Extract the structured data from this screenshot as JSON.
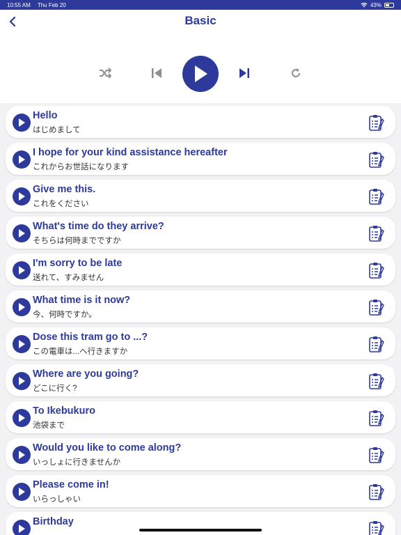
{
  "status_bar": {
    "time": "10:55 AM",
    "date": "Thu Feb 20",
    "battery": "43%",
    "wifi_icon": "wifi-icon",
    "battery_icon": "battery-icon"
  },
  "header": {
    "title": "Basic",
    "back_icon": "chevron-left-icon"
  },
  "player": {
    "shuffle_icon": "shuffle-icon",
    "prev_icon": "skip-previous-icon",
    "play_icon": "play-icon",
    "next_icon": "skip-next-icon",
    "repeat_icon": "repeat-icon"
  },
  "colors": {
    "accent": "#2d3a9b",
    "inactive_icon": "#8e8e93",
    "background": "#f2f2f4"
  },
  "phrases": [
    {
      "en": "Hello",
      "jp": "はじめまして"
    },
    {
      "en": "I hope for your kind assistance hereafter",
      "jp": "これからお世話になります"
    },
    {
      "en": "Give me this.",
      "jp": "これをください"
    },
    {
      "en": "What's time do they arrive?",
      "jp": "そちらは何時までですか"
    },
    {
      "en": "I'm sorry to be late",
      "jp": "送れて、すみません"
    },
    {
      "en": "What time is it now?",
      "jp": "今、何時ですか。"
    },
    {
      "en": "Dose this tram go to ...?",
      "jp": "この電車は...へ行きますか"
    },
    {
      "en": "Where are you going?",
      "jp": "どこに行く?"
    },
    {
      "en": "To Ikebukuro",
      "jp": "池袋まで"
    },
    {
      "en": "Would you like to come along?",
      "jp": "いっしょに行きませんか"
    },
    {
      "en": "Please come in!",
      "jp": "いらっしゃい"
    },
    {
      "en": "Birthday",
      "jp": ""
    }
  ]
}
